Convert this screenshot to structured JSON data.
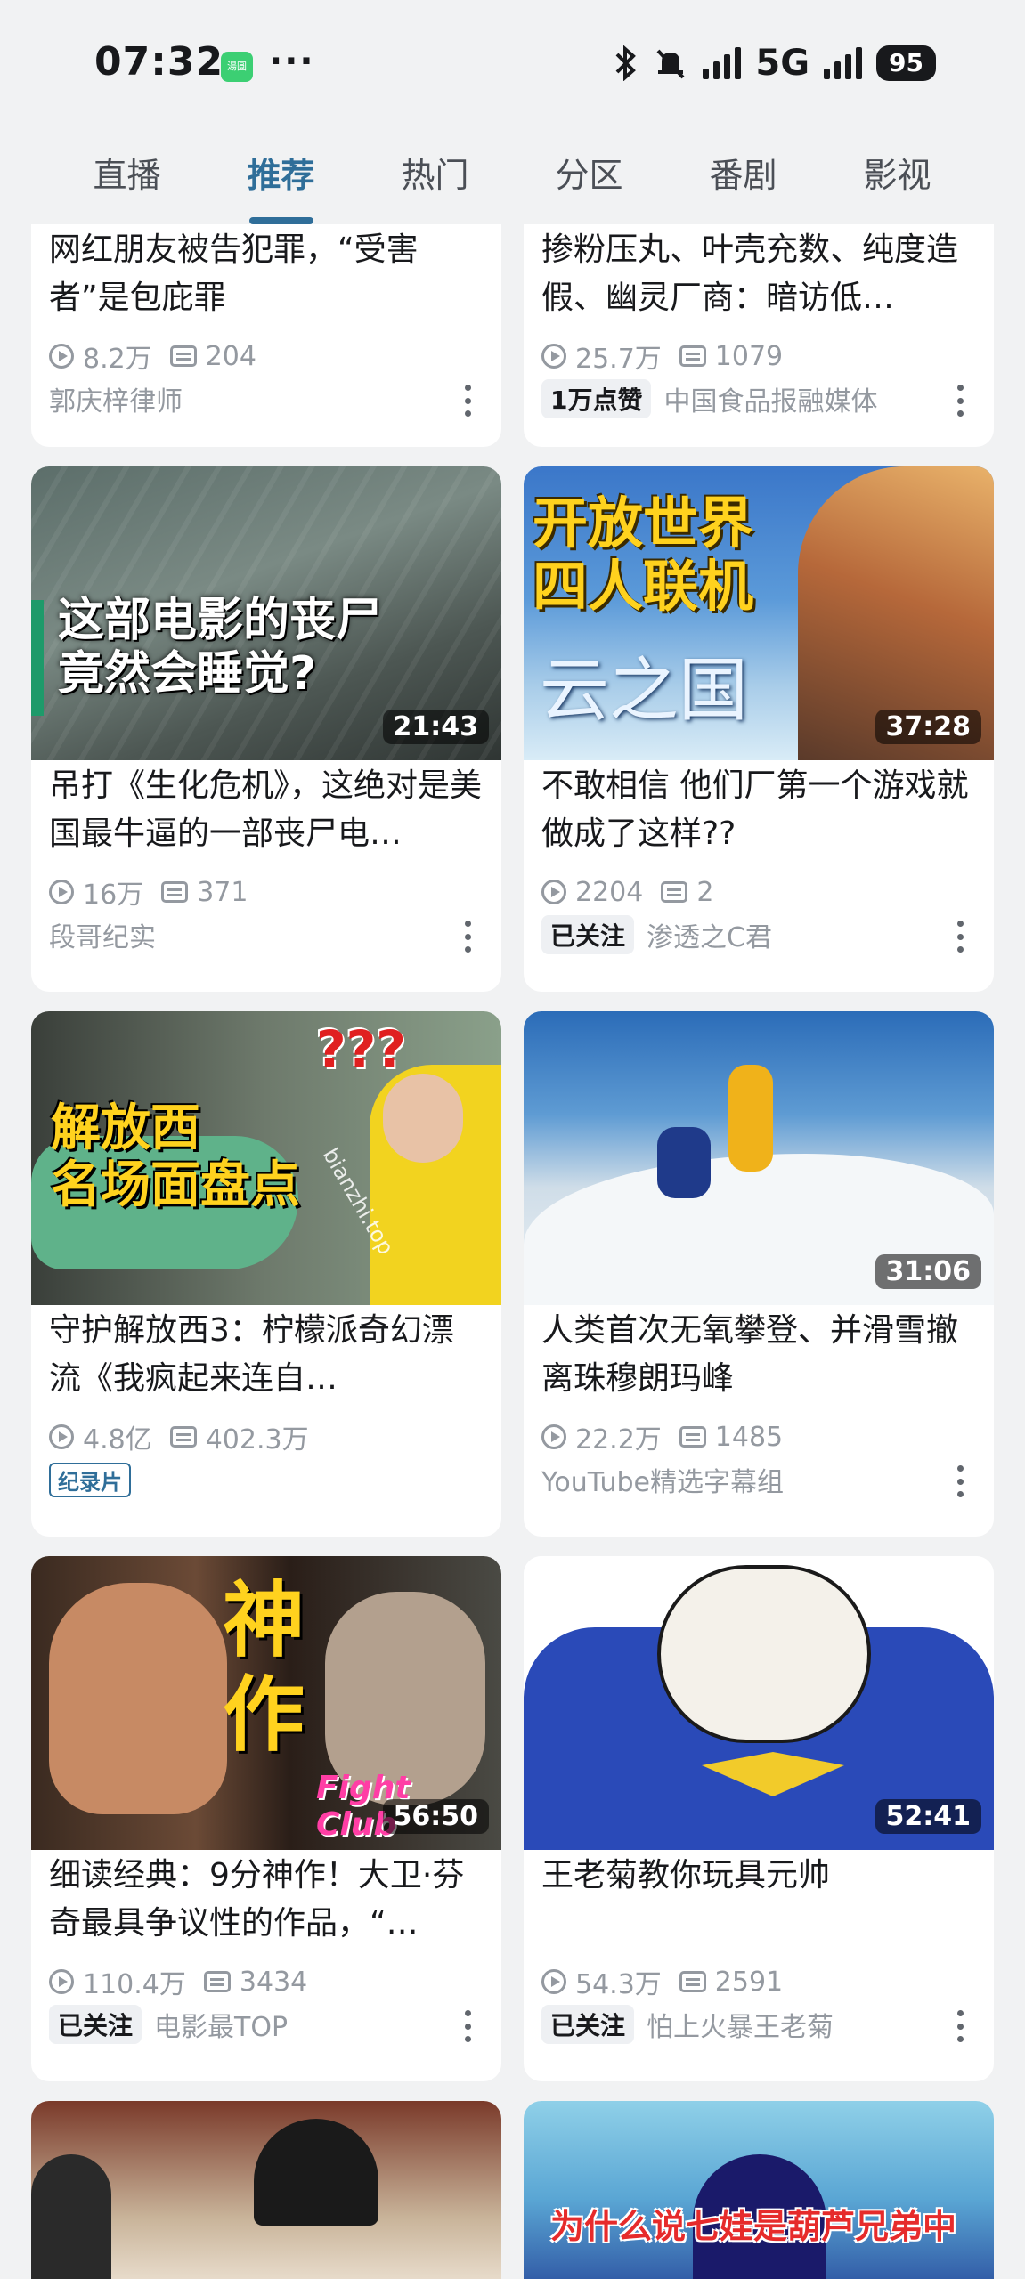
{
  "status": {
    "time": "07:32",
    "app_icon_text": "湯圓",
    "dots": "···",
    "network": "5G",
    "battery": "95"
  },
  "tabs": [
    {
      "label": "直播"
    },
    {
      "label": "推荐"
    },
    {
      "label": "热门"
    },
    {
      "label": "分区"
    },
    {
      "label": "番剧"
    },
    {
      "label": "影视"
    }
  ],
  "active_tab": "推荐",
  "cards": [
    {
      "title": "网红朋友被告犯罪，“受害者”是包庇罪",
      "views": "8.2万",
      "danmaku": "204",
      "badge": "",
      "author": "郭庆梓律师",
      "duration": ""
    },
    {
      "title": "掺粉压丸、叶壳充数、纯度造假、幽灵厂商：暗访低…",
      "views": "25.7万",
      "danmaku": "1079",
      "badge": "1万点赞",
      "author": "中国食品报融媒体",
      "duration": ""
    },
    {
      "title": "吊打《生化危机》，这绝对是美国最牛逼的一部丧尸电…",
      "views": "16万",
      "danmaku": "371",
      "badge": "",
      "author": "段哥纪实",
      "duration": "21:43",
      "overlay": "这部电影的丧尸\n竟然会睡觉?"
    },
    {
      "title": "不敢相信 他们厂第一个游戏就做成了这样??",
      "views": "2204",
      "danmaku": "2",
      "badge": "已关注",
      "author": "渗透之C君",
      "duration": "37:28",
      "overlay": "开放世界\n四人联机",
      "overlay2": "云之国"
    },
    {
      "title": "守护解放西3：柠檬派奇幻漂流《我疯起来连自…",
      "views": "4.8亿",
      "danmaku": "402.3万",
      "badge_outline": "纪录片",
      "author": "",
      "duration": "",
      "overlay": "解放西\n名场面盘点",
      "overlay2": "???",
      "watermark": "bianzhi.top"
    },
    {
      "title": "人类首次无氧攀登、并滑雪撤离珠穆朗玛峰",
      "views": "22.2万",
      "danmaku": "1485",
      "badge": "",
      "author": "YouTube精选字幕组",
      "duration": "31:06"
    },
    {
      "title": "细读经典：9分神作！大卫·芬奇最具争议性的作品，“…",
      "views": "110.4万",
      "danmaku": "3434",
      "badge": "已关注",
      "author": "电影最TOP",
      "duration": "56:50",
      "overlay": "神\n作",
      "overlay2": "Fight Club"
    },
    {
      "title": "王老菊教你玩具元帅",
      "views": "54.3万",
      "danmaku": "2591",
      "badge": "已关注",
      "author": "怕上火暴王老菊",
      "duration": "52:41"
    },
    {
      "overlay": "为什么说七娃是葫芦兄弟中"
    }
  ],
  "colors": {
    "accent": "#2f6e99",
    "background": "#f1f2f3",
    "card": "#ffffff",
    "muted": "#9499a0"
  }
}
